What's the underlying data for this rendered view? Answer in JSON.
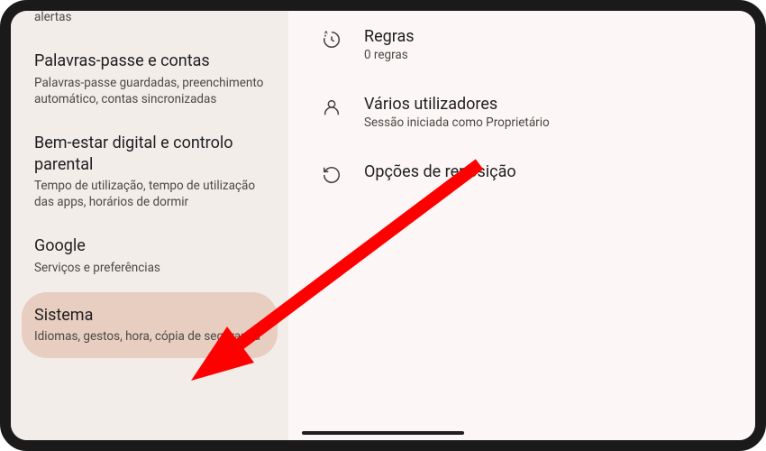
{
  "sidebar": {
    "items": [
      {
        "title": "",
        "subtitle": "Urgência SOS, informações médicas, alertas"
      },
      {
        "title": "Palavras-passe e contas",
        "subtitle": "Palavras-passe guardadas, preenchimento automático, contas sincronizadas"
      },
      {
        "title": "Bem-estar digital e controlo parental",
        "subtitle": "Tempo de utilização, tempo de utilização das apps, horários de dormir"
      },
      {
        "title": "Google",
        "subtitle": "Serviços e preferências"
      },
      {
        "title": "Sistema",
        "subtitle": "Idiomas, gestos, hora, cópia de segurança"
      }
    ]
  },
  "main": {
    "items": [
      {
        "title": "Regras",
        "subtitle": "0 regras"
      },
      {
        "title": "Vários utilizadores",
        "subtitle": "Sessão iniciada como Proprietário"
      },
      {
        "title": "Opções de reposição",
        "subtitle": ""
      }
    ]
  },
  "annotation": {
    "arrow_color": "#ff0000"
  }
}
